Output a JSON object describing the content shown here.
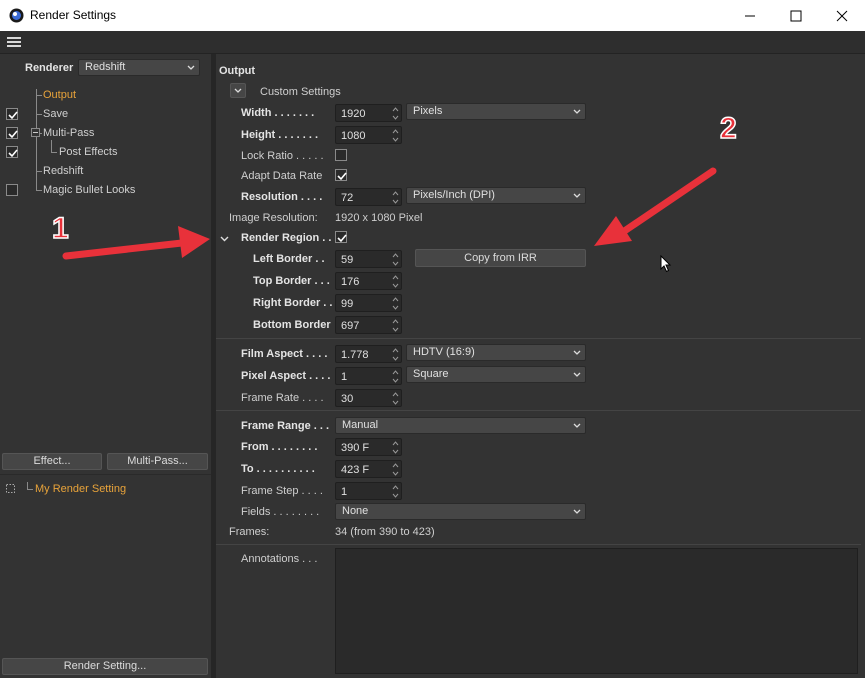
{
  "window": {
    "title": "Render Settings"
  },
  "sidebar": {
    "renderer_label": "Renderer",
    "renderer_value": "Redshift",
    "tree": [
      {
        "label": "Output",
        "active": true
      },
      {
        "label": "Save"
      },
      {
        "label": "Multi-Pass"
      },
      {
        "label": "Post Effects"
      },
      {
        "label": "Redshift"
      },
      {
        "label": "Magic Bullet Looks"
      }
    ],
    "effect_button": "Effect...",
    "multipass_button": "Multi-Pass...",
    "setting_name": "My Render Setting",
    "render_setting_button": "Render Setting..."
  },
  "output": {
    "section_title": "Output",
    "preset": "Custom Settings",
    "width_label": "Width . . . . . . .",
    "width_value": "1920",
    "width_unit": "Pixels",
    "height_label": "Height . . . . . . .",
    "height_value": "1080",
    "lock_ratio_label": "Lock Ratio . . . . .",
    "adapt_data_rate_label": "Adapt Data Rate",
    "resolution_label": "Resolution . . . .",
    "resolution_value": "72",
    "resolution_unit": "Pixels/Inch (DPI)",
    "image_resolution_label": "Image Resolution:",
    "image_resolution_value": "1920 x 1080 Pixel",
    "render_region_label": "Render Region . .",
    "left_border_label": "Left Border . .",
    "left_border_value": "59",
    "top_border_label": "Top Border . . .",
    "top_border_value": "176",
    "right_border_label": "Right Border . .",
    "right_border_value": "99",
    "bottom_border_label": "Bottom Border",
    "bottom_border_value": "697",
    "copy_from_irr": "Copy from IRR",
    "film_aspect_label": "Film Aspect . . . .",
    "film_aspect_value": "1.778",
    "film_aspect_preset": "HDTV (16:9)",
    "pixel_aspect_label": "Pixel Aspect . . . .",
    "pixel_aspect_value": "1",
    "pixel_aspect_preset": "Square",
    "frame_rate_label": "Frame Rate . . . .",
    "frame_rate_value": "30",
    "frame_range_label": "Frame Range . . .",
    "frame_range_value": "Manual",
    "from_label": "From . . . . . . . .",
    "from_value": "390 F",
    "to_label": "To . . . . . . . . . .",
    "to_value": "423 F",
    "frame_step_label": "Frame Step . . . .",
    "frame_step_value": "1",
    "fields_label": "Fields . . . . . . . .",
    "fields_value": "None",
    "frames_label": "Frames:",
    "frames_value": "34 (from 390 to 423)",
    "annotations_label": "Annotations . . ."
  },
  "annotations_overlay": {
    "arrow1_number": "1",
    "arrow2_number": "2"
  },
  "colors": {
    "accent": "#e8a33a",
    "arrow": "#e8313a",
    "panel": "#333333"
  }
}
